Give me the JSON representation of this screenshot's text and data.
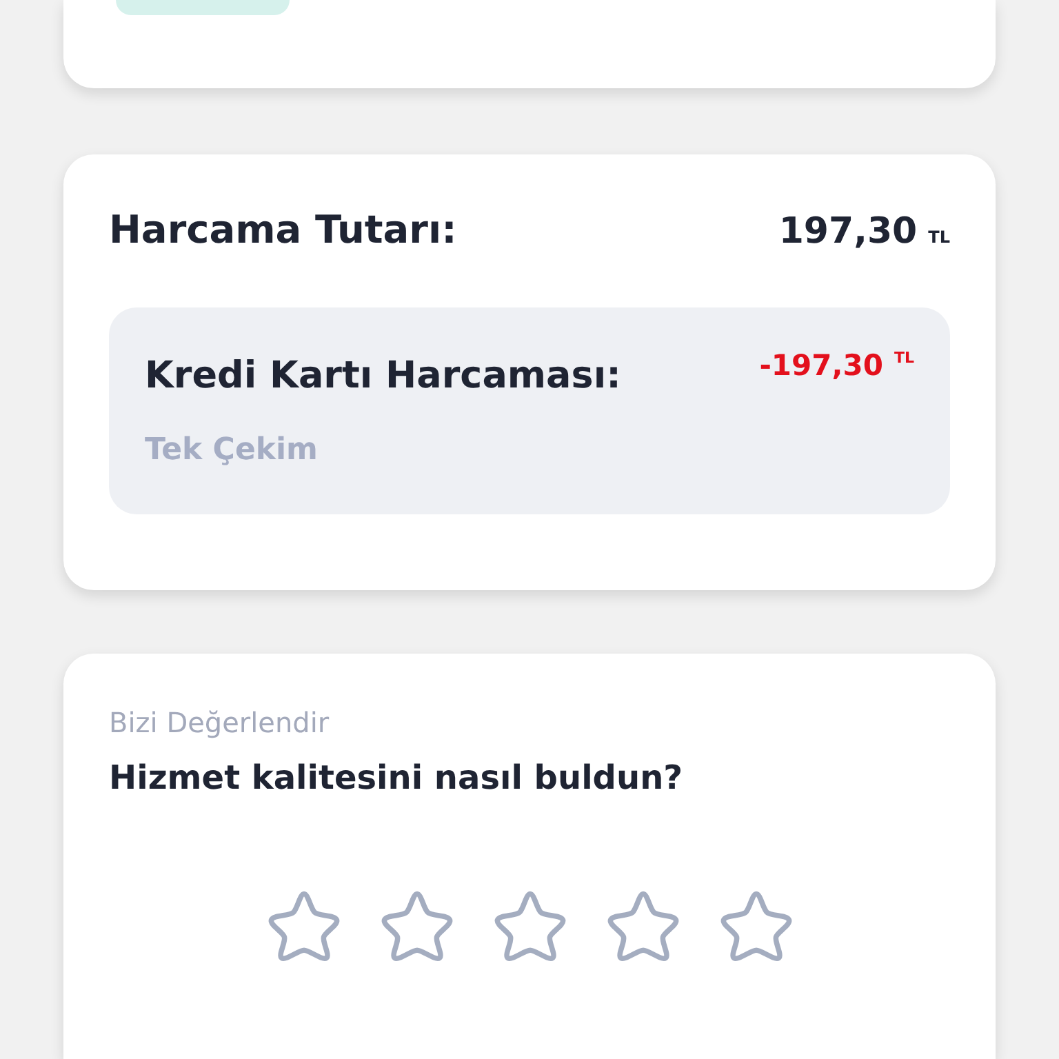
{
  "summary": {
    "title": "Harcama Tutarı:",
    "amount": "197,30",
    "currency": "TL"
  },
  "transaction": {
    "label": "Kredi Kartı Harcaması:",
    "amount": "-197,30",
    "currency": "TL",
    "detail": "Tek Çekim"
  },
  "rating": {
    "section": "Bizi Değerlendir",
    "question": "Hizmet kalitesini nasıl buldun?",
    "stars": 0
  }
}
